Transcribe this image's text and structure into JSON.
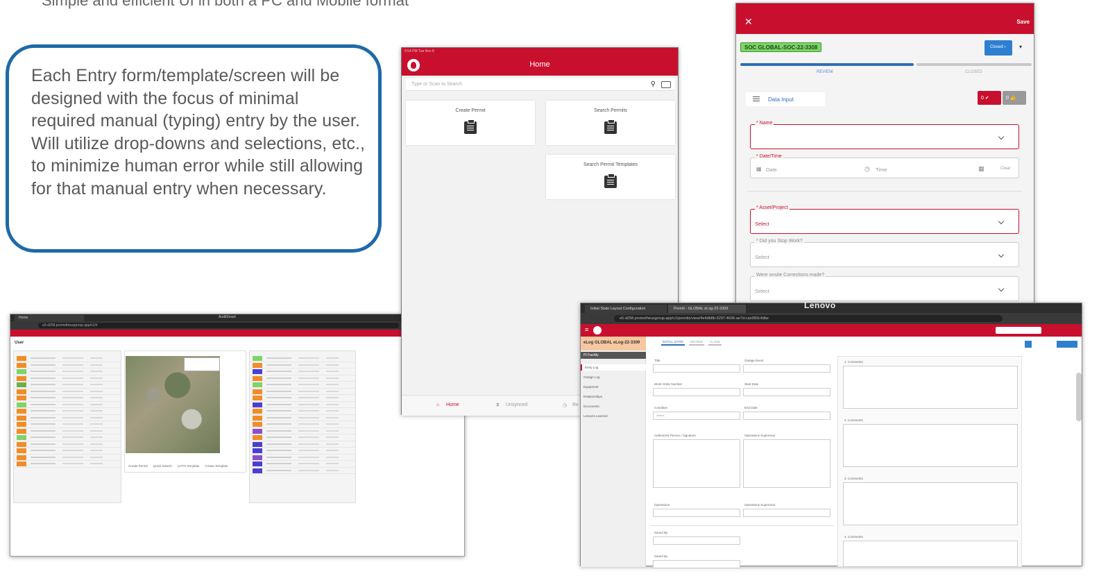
{
  "slide": {
    "top_caption": "Simple and efficient UI in both a PC and Mobile format",
    "callout_text": "Each Entry form/template/screen will be designed with the focus of minimal required manual (typing) entry by the user. Will utilize drop-downs and selections, etc., to minimize human error while still allowing for that manual entry when necessary."
  },
  "desktop_app": {
    "tab_label": "Home",
    "app_title": "AuditSmart",
    "url": "e5-d258.prometheusgroup.app/v1/#",
    "page_label": "User",
    "left_rows_colors": [
      "#f28c28",
      "#f28c28",
      "#7ed36a",
      "#f28c28",
      "#6ab04c",
      "#f28c28",
      "#f28c28",
      "#7ed36a",
      "#f28c28",
      "#f28c28",
      "#f28c28",
      "#f28c28",
      "#7ed36a",
      "#f28c28",
      "#f28c28",
      "#f28c28",
      "#f28c28"
    ],
    "right_rows_colors": [
      "#7ed36a",
      "#f28c28",
      "#4a3fd0",
      "#f28c28",
      "#7ed36a",
      "#f28c28",
      "#f28c28",
      "#4a3fd0",
      "#f28c28",
      "#f28c28",
      "#f28c28",
      "#8a4fd0",
      "#f28c28",
      "#4a3fd0",
      "#4a3fd0",
      "#8a4fd0",
      "#4a3fd0",
      "#4a3fd0"
    ],
    "map_footer_items": [
      "Create Permit",
      "Quick Search",
      "LOTO Template",
      "Create Template"
    ]
  },
  "tablet_home": {
    "title": "Home",
    "status_left": "5:54 PM  Tue Nov 8",
    "search_placeholder": "Type or Scan to Search",
    "cards": [
      "Create Permit",
      "Search Permits",
      "Search Permit Templates"
    ],
    "bottom_nav": [
      "Home",
      "Unsynced",
      "Re"
    ]
  },
  "mobile_form": {
    "close_glyph": "✕",
    "save_label": "Save",
    "soc_tag": "SOC GLOBAL-SOC-22-3308",
    "closed_button": "Closed  ›",
    "step_review": "REVIEW",
    "step_closed": "CLOSED",
    "data_input_label": "Data Input",
    "btn_red": "0 ✔",
    "btn_grey": "0 👍",
    "fields": [
      {
        "legend": "* Name",
        "value": ""
      },
      {
        "legend": "* Date/Time",
        "value": "Date",
        "value2": "Time",
        "value3": "Clear"
      },
      {
        "legend": "* Asset/Project",
        "value": "Select"
      },
      {
        "legend": "* Did you Stop Work?",
        "value": "Select"
      },
      {
        "legend": "Were onsite Corrections made?",
        "value": "Select"
      }
    ]
  },
  "elog": {
    "tab1": "Initial State Layout Configuration",
    "tab2": "Permit - GLOBAL eLog-22-3309",
    "brand": "Lenovo",
    "url": "e5-d258.prometheusgroup.app/v1/permits/view/4e4db8b-5297-4636-ae7d-cae083c4dbe",
    "tag": "eLog  GLOBAL eLog-22-3309",
    "stage_tabs": [
      "INITIAL STATE",
      "REVIEW",
      "CLOSE"
    ],
    "facility": "PI Facility",
    "nav": [
      "Entry Log",
      "Outage Log",
      "Equipment",
      "Relationships",
      "Documents",
      "Lessons Learned"
    ],
    "labels": [
      "Title",
      "Outage Event",
      "Work Order Number",
      "Start Date",
      "Condition",
      "End Date",
      "Authorized Person / Signature",
      "Operations Supervisor",
      "Operations",
      "Operations Supervisor",
      "Saved By",
      "Saved By"
    ],
    "comments": [
      "1. Comments",
      "2. Comments",
      "3. Comments",
      "4. Comments"
    ],
    "condition_select": "Select..."
  }
}
